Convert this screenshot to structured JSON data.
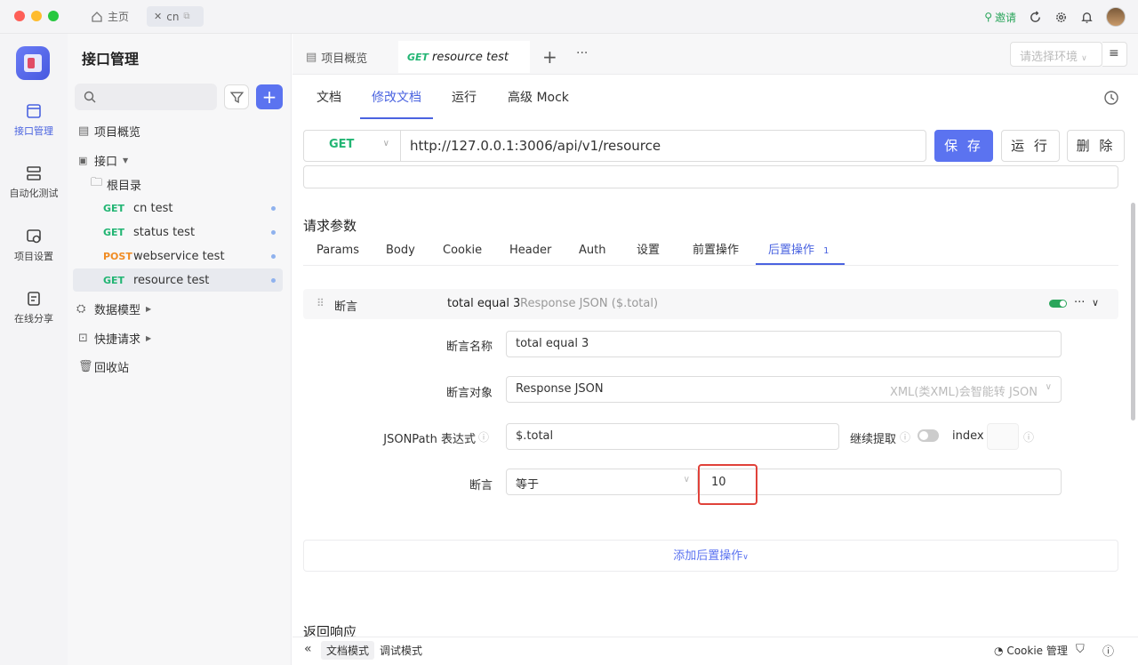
{
  "topbar": {
    "tabs": [
      {
        "label": "主页"
      },
      {
        "label": "cn"
      }
    ],
    "invite_label": "邀请"
  },
  "rail": {
    "items": [
      {
        "label": "接口管理"
      },
      {
        "label": "自动化测试"
      },
      {
        "label": "项目设置"
      },
      {
        "label": "在线分享"
      }
    ]
  },
  "sidebar": {
    "title": "接口管理",
    "overview": "项目概览",
    "interfaces": "接口",
    "root": "根目录",
    "apis": [
      {
        "method": "GET",
        "name": "cn test"
      },
      {
        "method": "GET",
        "name": "status test"
      },
      {
        "method": "POST",
        "name": "webservice test"
      },
      {
        "method": "GET",
        "name": "resource test"
      }
    ],
    "data_model": "数据模型",
    "quick_request": "快捷请求",
    "trash": "回收站"
  },
  "main_tabs": {
    "overview": "项目概览",
    "current_method": "GET",
    "current_name": "resource test",
    "env_placeholder": "请选择环境"
  },
  "doc_tabs": [
    "文档",
    "修改文档",
    "运行",
    "高级 Mock"
  ],
  "request": {
    "method": "GET",
    "url": "http://127.0.0.1:3006/api/v1/resource",
    "save": "保 存",
    "run": "运 行",
    "delete": "删 除"
  },
  "params": {
    "title": "请求参数",
    "tabs": [
      "Params",
      "Body",
      "Cookie",
      "Header",
      "Auth",
      "设置",
      "前置操作",
      "后置操作"
    ],
    "post_count": "1"
  },
  "assertion": {
    "head_label": "断言",
    "head_name": "total equal 3",
    "head_desc": "Response JSON ($.total)",
    "name_label": "断言名称",
    "name_value": "total equal 3",
    "target_label": "断言对象",
    "target_value": "Response JSON",
    "target_hint": "XML(类XML)会智能转 JSON",
    "jsonpath_label": "JSONPath 表达式",
    "jsonpath_value": "$.total",
    "continue_label": "继续提取",
    "index_label": "index",
    "assert_label": "断言",
    "operator": "等于",
    "expected": "10"
  },
  "add_post_op": "添加后置操作",
  "response_title": "返回响应",
  "bottom": {
    "doc_mode": "文档模式",
    "debug_mode": "调试模式",
    "cookie_manage": "Cookie 管理"
  }
}
